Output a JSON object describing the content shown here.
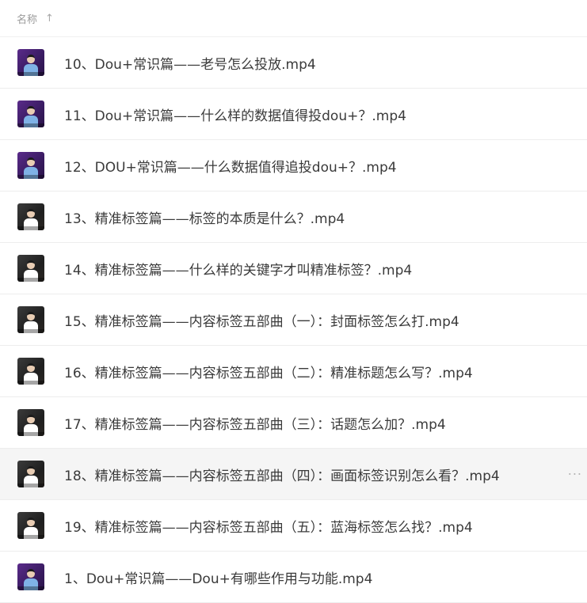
{
  "header": {
    "name_label": "名称",
    "sort_arrow": "↑"
  },
  "files": [
    {
      "name": "10、Dou+常识篇——老号怎么投放.mp4",
      "thumb": "purple"
    },
    {
      "name": "11、Dou+常识篇——什么样的数据值得投dou+？.mp4",
      "thumb": "purple"
    },
    {
      "name": "12、DOU+常识篇——什么数据值得追投dou+？.mp4",
      "thumb": "purple"
    },
    {
      "name": "13、精准标签篇——标签的本质是什么？.mp4",
      "thumb": "dark"
    },
    {
      "name": "14、精准标签篇——什么样的关键字才叫精准标签？.mp4",
      "thumb": "dark"
    },
    {
      "name": "15、精准标签篇——内容标签五部曲（一）：封面标签怎么打.mp4",
      "thumb": "dark"
    },
    {
      "name": "16、精准标签篇——内容标签五部曲（二）：精准标题怎么写？.mp4",
      "thumb": "dark"
    },
    {
      "name": "17、精准标签篇——内容标签五部曲（三）：话题怎么加？.mp4",
      "thumb": "dark"
    },
    {
      "name": "18、精准标签篇——内容标签五部曲（四）：画面标签识别怎么看？.mp4",
      "thumb": "dark"
    },
    {
      "name": "19、精准标签篇——内容标签五部曲（五）：蓝海标签怎么找？.mp4",
      "thumb": "dark"
    },
    {
      "name": "1、Dou+常识篇——Dou+有哪些作用与功能.mp4",
      "thumb": "purple"
    }
  ],
  "more_icon": "···"
}
